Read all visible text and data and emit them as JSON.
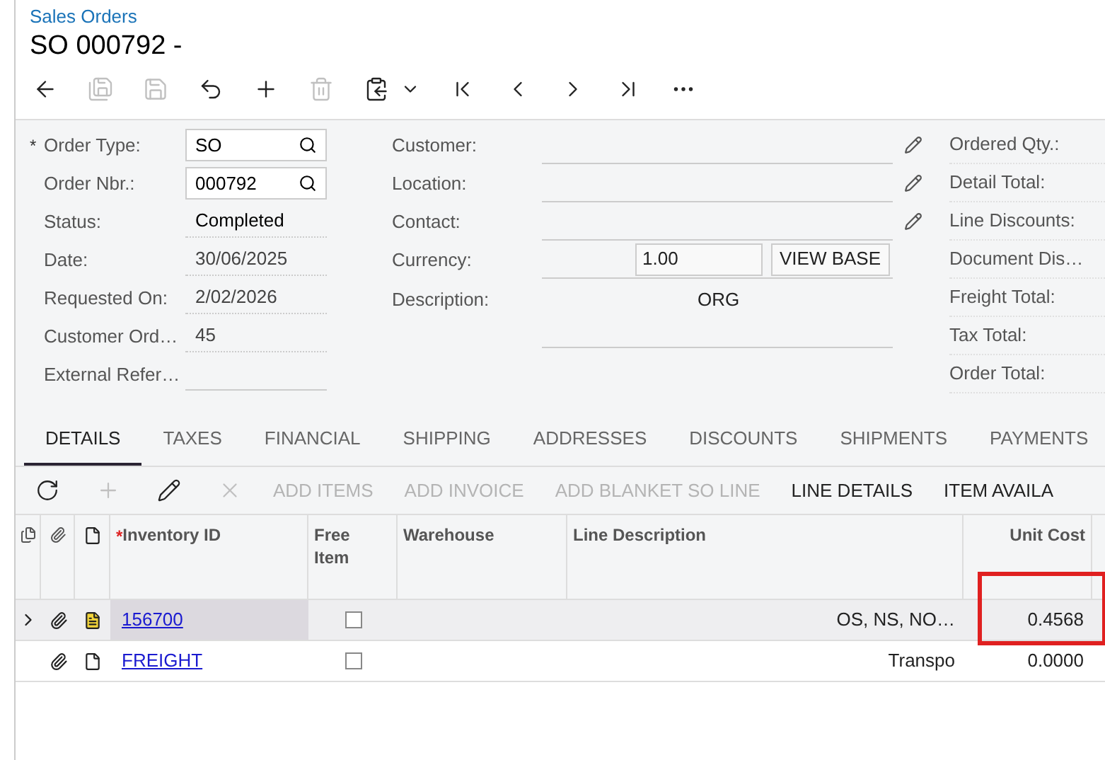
{
  "breadcrumb": "Sales Orders",
  "title": "SO 000792 -",
  "toolbar": [
    {
      "kind": "back",
      "disabled": false
    },
    {
      "kind": "save-close",
      "disabled": true
    },
    {
      "kind": "save",
      "disabled": true
    },
    {
      "kind": "undo",
      "disabled": false
    },
    {
      "kind": "add",
      "disabled": false
    },
    {
      "kind": "delete",
      "disabled": true
    },
    {
      "kind": "copy",
      "disabled": false
    },
    {
      "kind": "first",
      "disabled": false
    },
    {
      "kind": "prev",
      "disabled": false
    },
    {
      "kind": "next",
      "disabled": false
    },
    {
      "kind": "last",
      "disabled": false
    },
    {
      "kind": "more",
      "disabled": false
    }
  ],
  "form_left": [
    {
      "marker": "*",
      "label": "Order Type:",
      "value": "SO",
      "kind": "lookup"
    },
    {
      "label": "Order Nbr.:",
      "value": "000792",
      "kind": "lookup"
    },
    {
      "label": "Status:",
      "value": "Completed",
      "kind": "readonly"
    },
    {
      "label": "Date:",
      "value": "30/06/2025",
      "kind": "text"
    },
    {
      "label": "Requested On:",
      "value": "2/02/2026",
      "kind": "text"
    },
    {
      "label": "Customer Ord…",
      "value": "45",
      "kind": "text"
    },
    {
      "label": "External Refer…",
      "kind": "text"
    }
  ],
  "form_middle": [
    {
      "label": "Customer:",
      "kind": "text",
      "editable": true
    },
    {
      "label": "Location:",
      "kind": "text",
      "editable": true
    },
    {
      "label": "Contact:",
      "kind": "text",
      "editable": true
    },
    {
      "label": "Currency:",
      "kind": "currency",
      "value": "1.00",
      "button": "VIEW BASE",
      "editable": false
    },
    {
      "label": "Description:",
      "kind": "tall",
      "value": "ORG",
      "editable": false
    }
  ],
  "summary": [
    "Ordered Qty.:",
    "Detail Total:",
    "Line Discounts:",
    "Document Dis…",
    "Freight Total:",
    "Tax Total:",
    "Order Total:"
  ],
  "tabs": [
    {
      "label": "DETAILS",
      "selected": true
    },
    {
      "label": "TAXES",
      "selected": false
    },
    {
      "label": "FINANCIAL",
      "selected": false
    },
    {
      "label": "SHIPPING",
      "selected": false
    },
    {
      "label": "ADDRESSES",
      "selected": false
    },
    {
      "label": "DISCOUNTS",
      "selected": false
    },
    {
      "label": "SHIPMENTS",
      "selected": false
    },
    {
      "label": "PAYMENTS",
      "selected": false
    }
  ],
  "grid_toolbar": {
    "icons": [
      {
        "kind": "refresh",
        "disabled": false
      },
      {
        "kind": "add",
        "disabled": true
      },
      {
        "kind": "edit",
        "disabled": false
      },
      {
        "kind": "remove",
        "disabled": true
      }
    ],
    "buttons": [
      {
        "label": "ADD ITEMS",
        "disabled": true
      },
      {
        "label": "ADD INVOICE",
        "disabled": true
      },
      {
        "label": "ADD BLANKET SO LINE",
        "disabled": true
      },
      {
        "label": "LINE DETAILS",
        "disabled": false
      },
      {
        "label": "ITEM AVAILA",
        "disabled": false
      }
    ]
  },
  "columns": [
    {
      "marker": "*",
      "label": "Inventory ID"
    },
    {
      "label": "Free Item"
    },
    {
      "label": "Warehouse"
    },
    {
      "label": "Line Description"
    },
    {
      "label": "Unit Cost"
    }
  ],
  "rows": [
    {
      "selected": true,
      "has_note": true,
      "inventory_id": "156700",
      "free_item": false,
      "description": "OS, NS, NO…",
      "unit_cost": "0.4568",
      "highlighted": true
    },
    {
      "selected": false,
      "has_note": false,
      "inventory_id": "FREIGHT",
      "free_item": false,
      "description": "Transpo",
      "unit_cost": "0.0000",
      "highlighted": false
    }
  ]
}
